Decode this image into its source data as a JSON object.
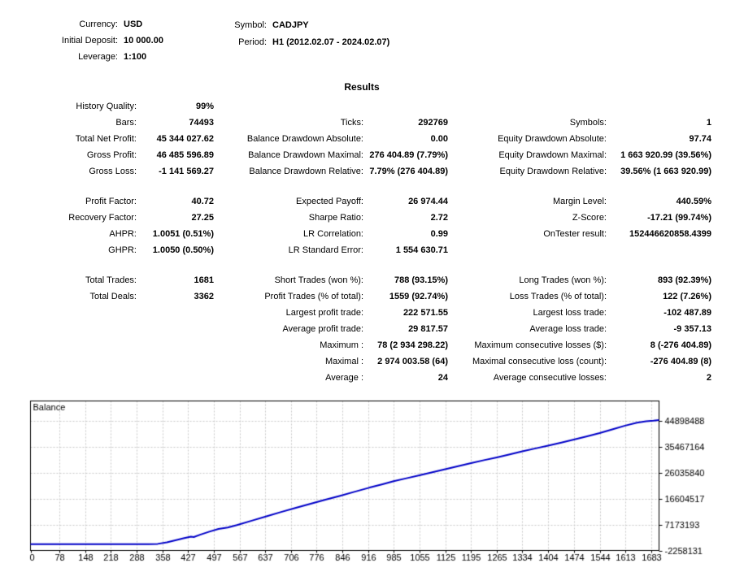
{
  "header": {
    "left": [
      {
        "label": "Currency:",
        "value": "USD"
      },
      {
        "label": "Initial Deposit:",
        "value": "10 000.00"
      },
      {
        "label": "Leverage:",
        "value": "1:100"
      }
    ],
    "right": [
      {
        "label": "Symbol:",
        "value": "CADJPY"
      },
      {
        "label": "Period:",
        "value": "H1 (2012.02.07 - 2024.02.07)"
      }
    ]
  },
  "results_title": "Results",
  "stats_blocks": [
    {
      "rows": [
        [
          "History Quality:",
          "99%",
          "",
          "",
          "",
          ""
        ],
        [
          "Bars:",
          "74493",
          "Ticks:",
          "292769",
          "Symbols:",
          "1"
        ],
        [
          "Total Net Profit:",
          "45 344 027.62",
          "Balance Drawdown Absolute:",
          "0.00",
          "Equity Drawdown Absolute:",
          "97.74"
        ],
        [
          "Gross Profit:",
          "46 485 596.89",
          "Balance Drawdown Maximal:",
          "276 404.89 (7.79%)",
          "Equity Drawdown Maximal:",
          "1 663 920.99 (39.56%)"
        ],
        [
          "Gross Loss:",
          "-1 141 569.27",
          "Balance Drawdown Relative:",
          "7.79% (276 404.89)",
          "Equity Drawdown Relative:",
          "39.56% (1 663 920.99)"
        ]
      ]
    },
    {
      "rows": [
        [
          "Profit Factor:",
          "40.72",
          "Expected Payoff:",
          "26 974.44",
          "Margin Level:",
          "440.59%"
        ],
        [
          "Recovery Factor:",
          "27.25",
          "Sharpe Ratio:",
          "2.72",
          "Z-Score:",
          "-17.21 (99.74%)"
        ],
        [
          "AHPR:",
          "1.0051 (0.51%)",
          "LR Correlation:",
          "0.99",
          "OnTester result:",
          "152446620858.4399"
        ],
        [
          "GHPR:",
          "1.0050 (0.50%)",
          "LR Standard Error:",
          "1 554 630.71",
          "",
          ""
        ]
      ]
    },
    {
      "rows": [
        [
          "Total Trades:",
          "1681",
          "Short Trades (won %):",
          "788 (93.15%)",
          "Long Trades (won %):",
          "893 (92.39%)"
        ],
        [
          "Total Deals:",
          "3362",
          "Profit Trades (% of total):",
          "1559 (92.74%)",
          "Loss Trades (% of total):",
          "122 (7.26%)"
        ],
        [
          "",
          "",
          "Largest profit trade:",
          "222 571.55",
          "Largest loss trade:",
          "-102 487.89"
        ],
        [
          "",
          "",
          "Average profit trade:",
          "29 817.57",
          "Average loss trade:",
          "-9 357.13"
        ],
        [
          "",
          "",
          "Maximum :",
          "78 (2 934 298.22)",
          "Maximum consecutive losses ($):",
          "8 (-276 404.89)"
        ],
        [
          "",
          "",
          "Maximal :",
          "2 974 003.58 (64)",
          "Maximal consecutive loss (count):",
          "-276 404.89 (8)"
        ],
        [
          "",
          "",
          "Average :",
          "24",
          "Average consecutive losses:",
          "2"
        ]
      ]
    }
  ],
  "chart_data": {
    "type": "line",
    "title": "Balance",
    "legend_position": "top-left",
    "grid": true,
    "line_color": "#0000C8",
    "grid_color": "#c9c9c9",
    "border_color": "#000000",
    "xlim": [
      0,
      1705
    ],
    "ylim": [
      -2258131,
      52312958
    ],
    "x_ticks": [
      0,
      78,
      148,
      218,
      288,
      358,
      427,
      497,
      567,
      637,
      706,
      776,
      846,
      916,
      985,
      1055,
      1125,
      1195,
      1265,
      1334,
      1404,
      1474,
      1544,
      1613,
      1683
    ],
    "y_ticks": [
      44898488,
      35467164,
      26035840,
      16604517,
      7173193,
      -2258131
    ],
    "series": [
      {
        "name": "Balance",
        "x": [
          0,
          320,
          345,
          370,
          395,
          415,
          435,
          443,
          460,
          485,
          510,
          535,
          560,
          600,
          640,
          680,
          720,
          760,
          800,
          840,
          880,
          920,
          955,
          985,
          1020,
          1055,
          1090,
          1125,
          1160,
          1195,
          1230,
          1265,
          1300,
          1334,
          1370,
          1404,
          1440,
          1474,
          1510,
          1544,
          1580,
          1613,
          1645,
          1670,
          1690,
          1705
        ],
        "values": [
          10000,
          10000,
          150000,
          700000,
          1500000,
          2200000,
          2800000,
          2650000,
          3500000,
          4600000,
          5600000,
          6100000,
          7000000,
          8600000,
          10200000,
          11800000,
          13300000,
          14800000,
          16300000,
          17700000,
          19200000,
          20700000,
          21900000,
          23000000,
          24100000,
          25200000,
          26300000,
          27400000,
          28500000,
          29600000,
          30700000,
          31700000,
          32800000,
          33900000,
          35000000,
          36000000,
          37100000,
          38200000,
          39400000,
          40600000,
          42000000,
          43300000,
          44400000,
          44900000,
          45100000,
          45344028
        ]
      }
    ]
  }
}
